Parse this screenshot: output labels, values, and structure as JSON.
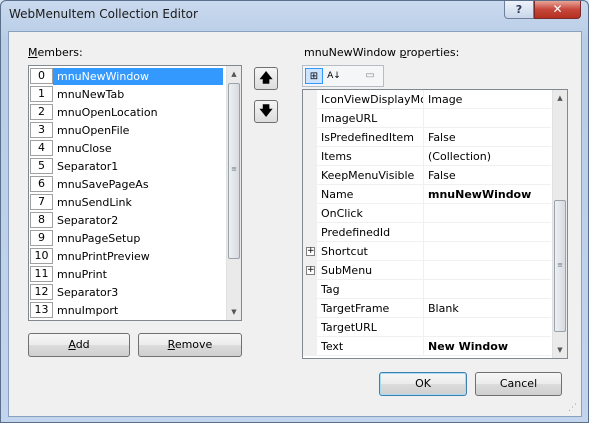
{
  "window": {
    "title": "WebMenuItem Collection Editor",
    "help_label": "?",
    "close_label": "✕"
  },
  "members": {
    "label_underlined": "M",
    "label_rest": "embers:",
    "items": [
      {
        "index": "0",
        "name": "mnuNewWindow",
        "selected": true
      },
      {
        "index": "1",
        "name": "mnuNewTab"
      },
      {
        "index": "2",
        "name": "mnuOpenLocation"
      },
      {
        "index": "3",
        "name": "mnuOpenFile"
      },
      {
        "index": "4",
        "name": "mnuClose"
      },
      {
        "index": "5",
        "name": "Separator1"
      },
      {
        "index": "6",
        "name": "mnuSavePageAs"
      },
      {
        "index": "7",
        "name": "mnuSendLink"
      },
      {
        "index": "8",
        "name": "Separator2"
      },
      {
        "index": "9",
        "name": "mnuPageSetup"
      },
      {
        "index": "10",
        "name": "mnuPrintPreview"
      },
      {
        "index": "11",
        "name": "mnuPrint"
      },
      {
        "index": "12",
        "name": "Separator3"
      },
      {
        "index": "13",
        "name": "mnuImport"
      }
    ],
    "move_up_glyph": "🡅",
    "move_down_glyph": "🡇"
  },
  "buttons": {
    "add_underlined": "A",
    "add_rest": "dd",
    "remove_underlined": "R",
    "remove_rest": "emove",
    "ok": "OK",
    "cancel": "Cancel"
  },
  "properties": {
    "label_prefix": "mnuNewWindow ",
    "label_underlined": "p",
    "label_rest": "roperties:",
    "toolbar": [
      {
        "icon": "categorized-icon",
        "glyph": "⊞",
        "active": true
      },
      {
        "icon": "alphabetical-icon",
        "glyph": "A↓"
      },
      {
        "icon": "property-pages-icon",
        "glyph": "▭"
      }
    ],
    "rows": [
      {
        "name": "IconViewDisplayMc",
        "value": "Image"
      },
      {
        "name": "ImageURL",
        "value": ""
      },
      {
        "name": "IsPredefinedItem",
        "value": "False"
      },
      {
        "name": "Items",
        "value": "(Collection)"
      },
      {
        "name": "KeepMenuVisible",
        "value": "False"
      },
      {
        "name": "Name",
        "value": "mnuNewWindow",
        "bold": true
      },
      {
        "name": "OnClick",
        "value": ""
      },
      {
        "name": "PredefinedId",
        "value": ""
      },
      {
        "name": "Shortcut",
        "value": "",
        "expandable": true
      },
      {
        "name": "SubMenu",
        "value": "",
        "expandable": true
      },
      {
        "name": "Tag",
        "value": ""
      },
      {
        "name": "TargetFrame",
        "value": "Blank"
      },
      {
        "name": "TargetURL",
        "value": ""
      },
      {
        "name": "Text",
        "value": "New Window",
        "bold": true
      }
    ]
  },
  "colors": {
    "selection": "#3399ff",
    "dialog_bg": "#f0f0f0",
    "title_bg": "#c9d9ee"
  }
}
